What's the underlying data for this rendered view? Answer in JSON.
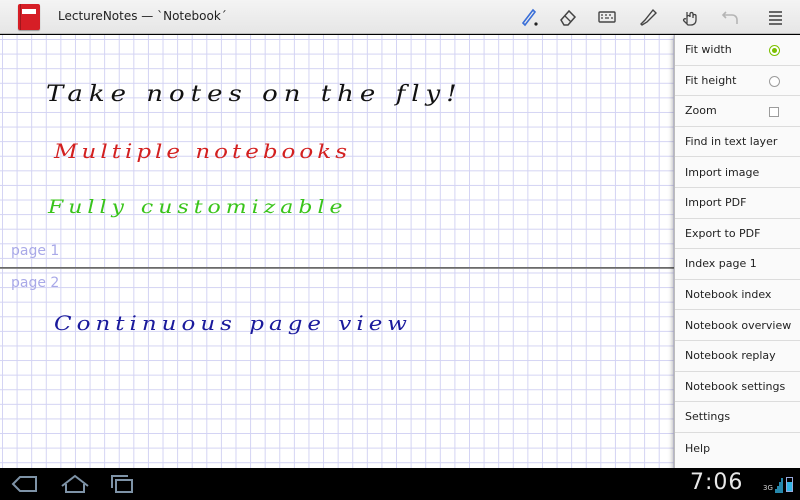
{
  "app": {
    "title": "LectureNotes — `Notebook´"
  },
  "toolbar": {
    "tools": [
      {
        "icon": "pen-icon",
        "color": "#3a6fd8"
      },
      {
        "icon": "eraser-icon"
      },
      {
        "icon": "keyboard-icon"
      },
      {
        "icon": "highlighter-icon"
      },
      {
        "icon": "hand-icon"
      },
      {
        "icon": "undo-icon"
      },
      {
        "icon": "overflow-menu-icon"
      }
    ]
  },
  "notebook": {
    "pages": [
      {
        "label": "page 1"
      },
      {
        "label": "page 2"
      }
    ],
    "handwriting": [
      {
        "text": "Take notes on the fly!",
        "color": "#111111"
      },
      {
        "text": "Multiple notebooks",
        "color": "#d32020"
      },
      {
        "text": "Fully customizable",
        "color": "#39c41a"
      },
      {
        "text": "Continuous page view",
        "color": "#1a1a9c"
      }
    ],
    "grid_color": "#d3d3f3"
  },
  "menu": {
    "items": [
      {
        "label": "Fit width",
        "control": "radio",
        "checked": true
      },
      {
        "label": "Fit height",
        "control": "radio",
        "checked": false
      },
      {
        "label": "Zoom",
        "control": "checkbox",
        "checked": false
      },
      {
        "label": "Find in text layer"
      },
      {
        "label": "Import image"
      },
      {
        "label": "Import PDF"
      },
      {
        "label": "Export to PDF"
      },
      {
        "label": "Index page 1"
      },
      {
        "label": "Notebook index"
      },
      {
        "label": "Notebook overview"
      },
      {
        "label": "Notebook replay"
      },
      {
        "label": "Notebook settings"
      },
      {
        "label": "Settings"
      },
      {
        "label": "Help"
      }
    ],
    "accent": "#7cc000"
  },
  "system": {
    "time": "7:06",
    "network": "3G",
    "nav": [
      "back-icon",
      "home-icon",
      "recent-apps-icon"
    ]
  }
}
